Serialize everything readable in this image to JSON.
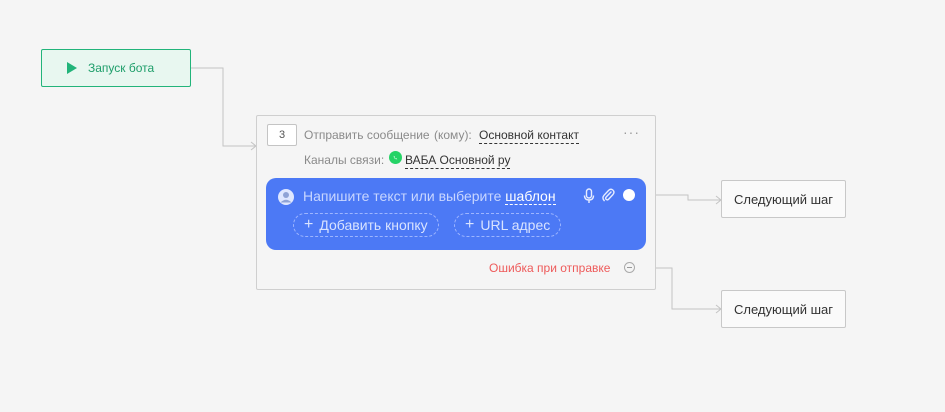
{
  "start_node": {
    "label": "Запуск бота"
  },
  "step": {
    "number": "3",
    "action": "Отправить сообщение",
    "recipient_prefix": "(кому):",
    "recipient": "Основной контакт",
    "channels_label": "Каналы связи:",
    "channel": "ВАБА Основной ру",
    "more": "···",
    "composer": {
      "placeholder_prefix": "Напишите текст или выберите",
      "template_link": "шаблон",
      "add_button": "Добавить кнопку",
      "url_button": "URL адрес"
    },
    "error_label": "Ошибка при отправке"
  },
  "next_steps": [
    {
      "label": "Следующий шаг"
    },
    {
      "label": "Следующий шаг"
    }
  ],
  "colors": {
    "start_green": "#22b47a",
    "composer_blue": "#4c79f5",
    "error_red": "#ee5a5a",
    "whatsapp_green": "#25d366"
  }
}
